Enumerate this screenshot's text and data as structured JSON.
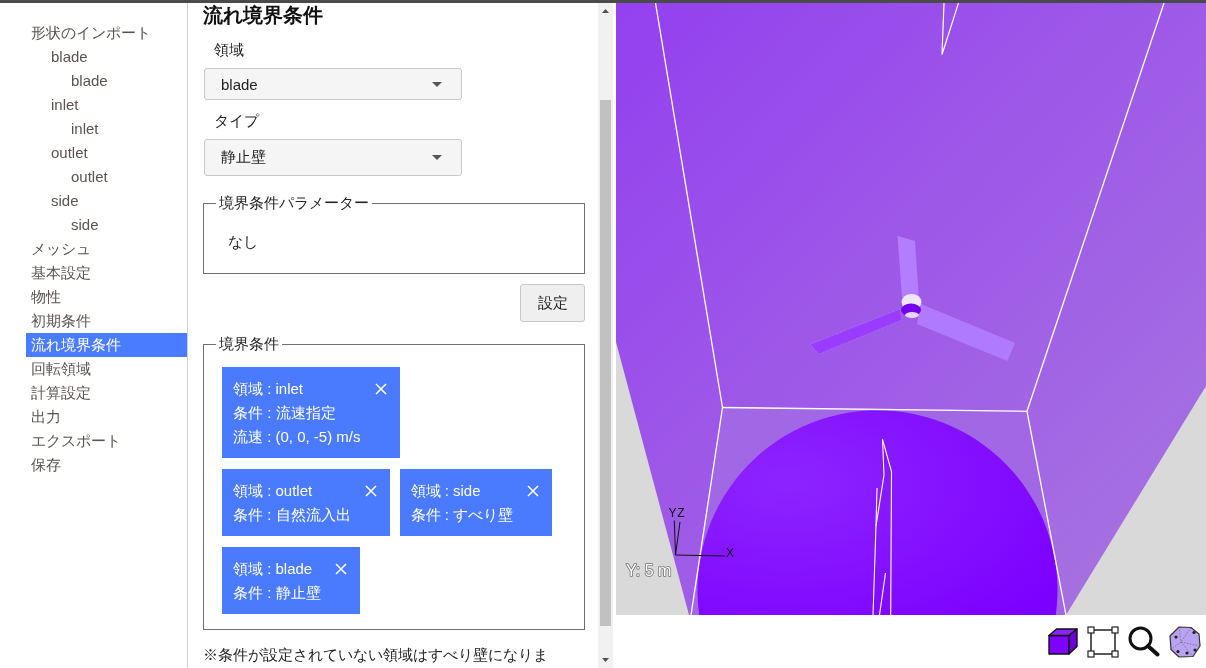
{
  "sidebar": {
    "items": [
      {
        "label": "形状のインポート",
        "selected": false,
        "children": [
          {
            "label": "blade",
            "selected": false,
            "children": [
              {
                "label": "blade",
                "selected": false
              }
            ]
          },
          {
            "label": "inlet",
            "selected": false,
            "children": [
              {
                "label": "inlet",
                "selected": false
              }
            ]
          },
          {
            "label": "outlet",
            "selected": false,
            "children": [
              {
                "label": "outlet",
                "selected": false
              }
            ]
          },
          {
            "label": "side",
            "selected": false,
            "children": [
              {
                "label": "side",
                "selected": false
              }
            ]
          }
        ]
      },
      {
        "label": "メッシュ",
        "selected": false
      },
      {
        "label": "基本設定",
        "selected": false
      },
      {
        "label": "物性",
        "selected": false
      },
      {
        "label": "初期条件",
        "selected": false
      },
      {
        "label": "流れ境界条件",
        "selected": true
      },
      {
        "label": "回転領域",
        "selected": false
      },
      {
        "label": "計算設定",
        "selected": false
      },
      {
        "label": "出力",
        "selected": false
      },
      {
        "label": "エクスポート",
        "selected": false
      },
      {
        "label": "保存",
        "selected": false
      }
    ]
  },
  "panel": {
    "title": "流れ境界条件",
    "region": {
      "label": "領域",
      "value": "blade"
    },
    "type": {
      "label": "タイプ",
      "value": "静止壁"
    },
    "parameters": {
      "legend": "境界条件パラメーター",
      "text": "なし"
    },
    "set_button": "設定",
    "conditions": {
      "legend": "境界条件",
      "cards": [
        {
          "lines": [
            "領域 : inlet",
            "条件 : 流速指定",
            "流速 : (0, 0, -5) m/s"
          ]
        },
        {
          "lines": [
            "領域 : outlet",
            "条件 : 自然流入出"
          ]
        },
        {
          "lines": [
            "領域 : side",
            "条件 : すべり壁"
          ]
        },
        {
          "lines": [
            "領域 : blade",
            "条件 : 静止壁"
          ]
        }
      ]
    },
    "note": "※条件が設定されていない領域はすべり壁になりま"
  },
  "viewport": {
    "axis_gizmo": {
      "y_label": "Y",
      "z_label": "Z",
      "x_label": "X"
    },
    "scale_label": "Y: 5 m"
  }
}
